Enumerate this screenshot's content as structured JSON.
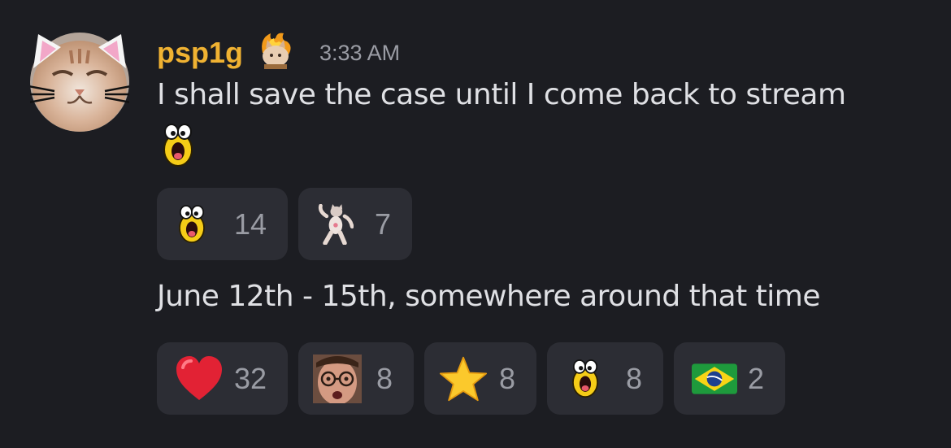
{
  "message": {
    "author": "psp1g",
    "timestamp": "3:33 AM",
    "role_icon": "fire-cat-icon",
    "avatar": "cat-face-avatar",
    "line1": "I shall save the case until I come back to stream",
    "line1_emoji": "screaming-yellow-emoji",
    "reactions1": [
      {
        "emoji": "screaming-yellow-emoji",
        "count": "14"
      },
      {
        "emoji": "dancing-cat-emoji",
        "count": "7"
      }
    ],
    "line2": "June 12th - 15th, somewhere around that time",
    "reactions2": [
      {
        "emoji": "red-heart-emoji",
        "count": "32"
      },
      {
        "emoji": "face-photo-emoji",
        "count": "8"
      },
      {
        "emoji": "star-emoji",
        "count": "8"
      },
      {
        "emoji": "screaming-yellow-emoji",
        "count": "8"
      },
      {
        "emoji": "brazil-flag-emoji",
        "count": "2"
      }
    ]
  },
  "colors": {
    "background": "#1c1d22",
    "username": "#f0b232",
    "reaction_bg": "#2c2d34",
    "muted_text": "#9a9ca4",
    "body_text": "#dfe0e4"
  }
}
